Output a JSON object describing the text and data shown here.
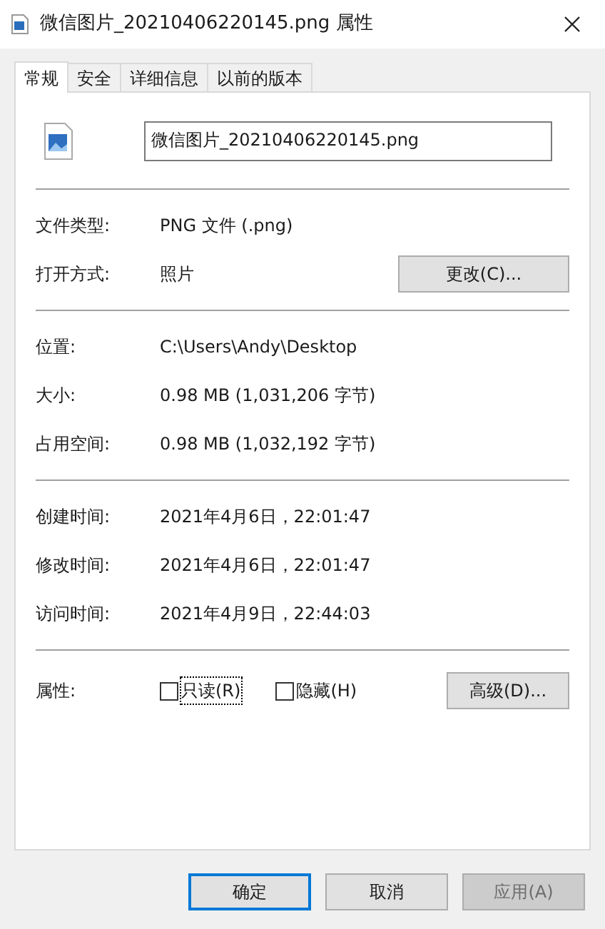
{
  "window": {
    "title": "微信图片_20210406220145.png 属性"
  },
  "tabs": [
    {
      "label": "常规",
      "selected": true
    },
    {
      "label": "安全",
      "selected": false
    },
    {
      "label": "详细信息",
      "selected": false
    },
    {
      "label": "以前的版本",
      "selected": false
    }
  ],
  "file_name": {
    "value": "微信图片_20210406220145.png"
  },
  "sections": [
    [
      {
        "label": "文件类型:",
        "value": "PNG 文件 (.png)"
      },
      {
        "label": "打开方式:",
        "value": "照片",
        "button": "更改(C)..."
      }
    ],
    [
      {
        "label": "位置:",
        "value": "C:\\Users\\Andy\\Desktop"
      },
      {
        "label": "大小:",
        "value": "0.98 MB (1,031,206 字节)"
      },
      {
        "label": "占用空间:",
        "value": "0.98 MB (1,032,192 字节)"
      }
    ],
    [
      {
        "label": "创建时间:",
        "value": "2021年4月6日，22:01:47"
      },
      {
        "label": "修改时间:",
        "value": "2021年4月6日，22:01:47"
      },
      {
        "label": "访问时间:",
        "value": "2021年4月9日，22:44:03"
      }
    ]
  ],
  "attributes": {
    "label": "属性:",
    "checkboxes": [
      {
        "label": "只读(R)",
        "checked": false,
        "focused": true
      },
      {
        "label": "隐藏(H)",
        "checked": false,
        "focused": false
      }
    ],
    "button": "高级(D)..."
  },
  "buttons": [
    {
      "label": "确定",
      "default": true,
      "disabled": false
    },
    {
      "label": "取消",
      "default": false,
      "disabled": false
    },
    {
      "label": "应用(A)",
      "default": false,
      "disabled": true
    }
  ]
}
